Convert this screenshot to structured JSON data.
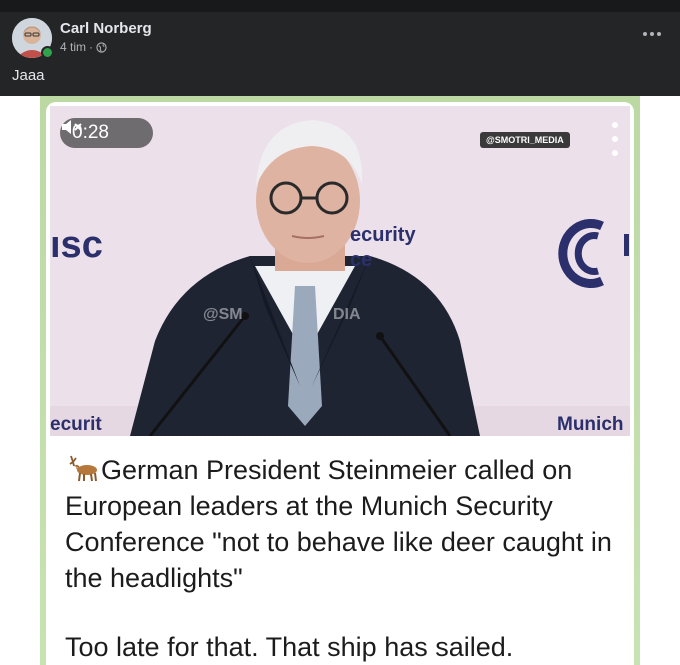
{
  "post": {
    "author": "Carl Norberg",
    "time_ago": "4 tim",
    "separator": "·",
    "privacy_icon": "globe-icon",
    "more_icon": "more-options-icon",
    "caption": "Jaaa"
  },
  "video": {
    "timestamp": "0:28",
    "mute_icon": "muted-speaker-icon",
    "watermark": "@SMOTRI_MEDIA",
    "background_texts": {
      "msc": "ısc",
      "security": "ecurity",
      "ce": "ce",
      "ecurit": "ecurit",
      "munich": "Munich",
      "center_watermark": "@SM",
      "center_watermark2": "DIA"
    }
  },
  "text": {
    "emoji": "deer-icon",
    "headline": "German President Steinmeier called on European leaders at the Munich Security Conference \"not to behave like deer caught in the headlights\"",
    "closing": "Too late for that. That ship has sailed."
  },
  "colors": {
    "background": "#242526",
    "online": "#31a24c",
    "frame_green": "#bcd9a4",
    "video_bg": "#ecdfe8",
    "msc_navy": "#2b2f6b"
  }
}
